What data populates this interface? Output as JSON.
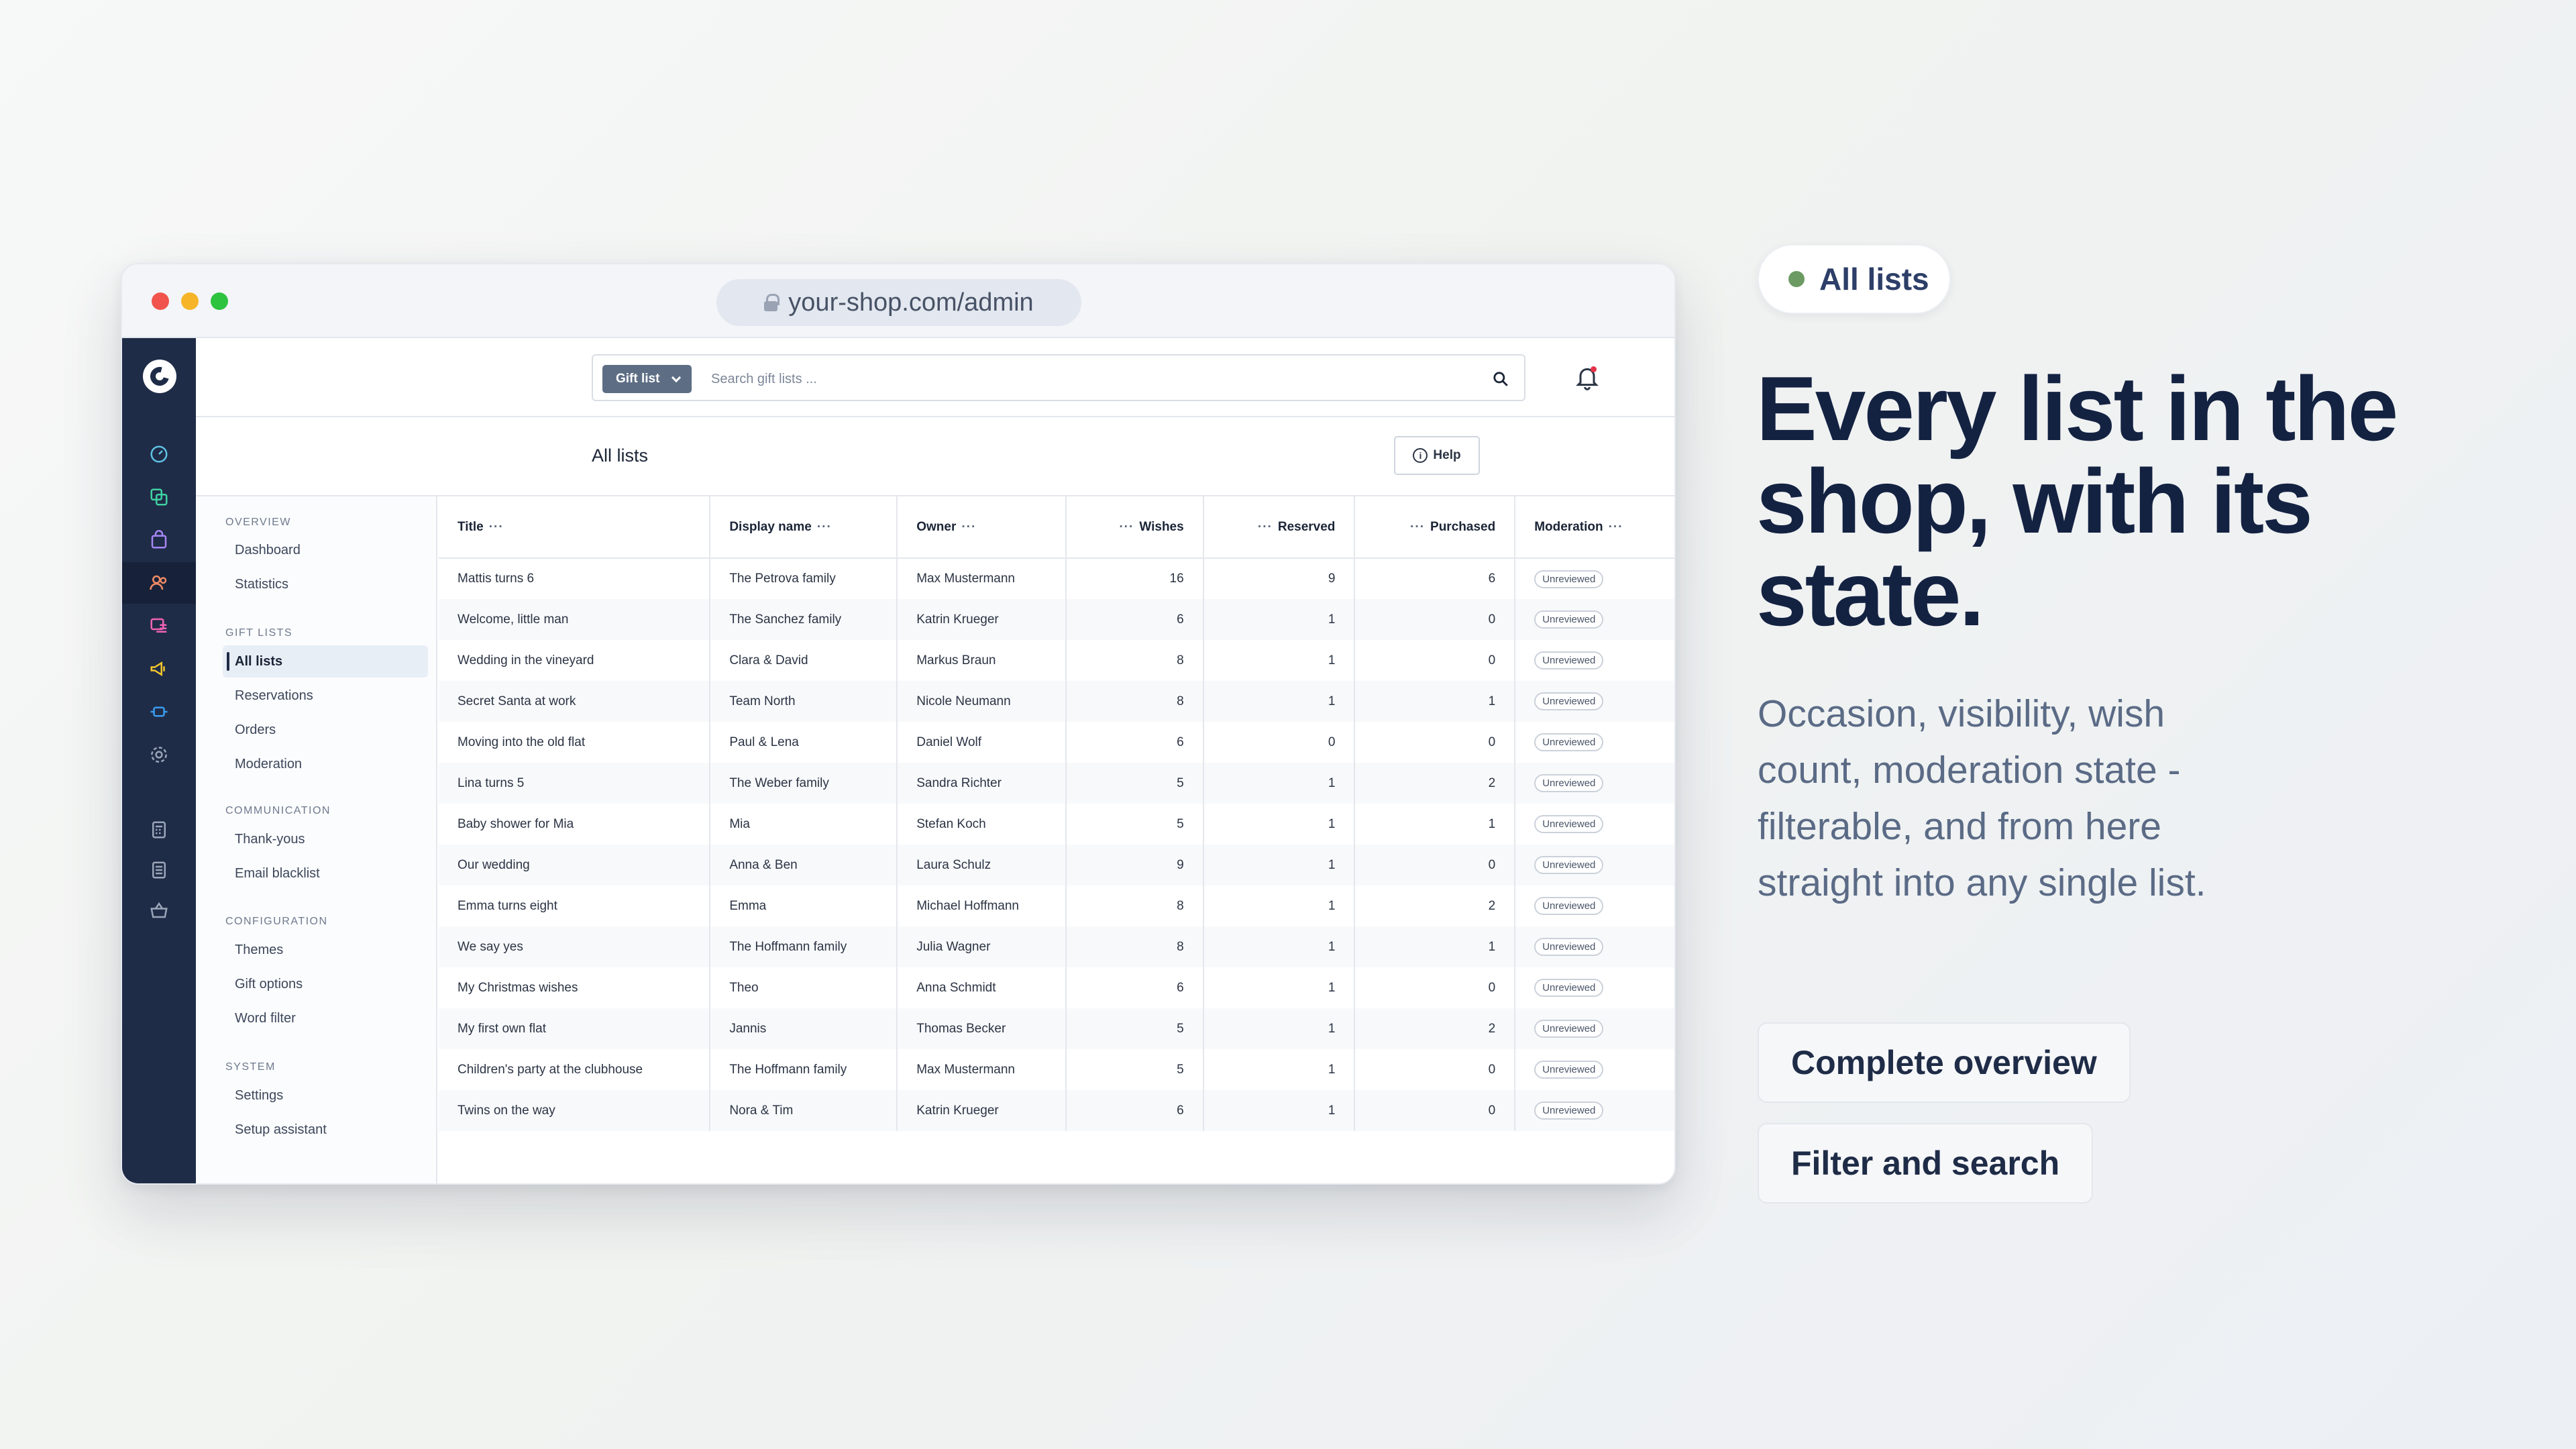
{
  "browser": {
    "url": "your-shop.com/admin"
  },
  "search": {
    "tag_label": "Gift list",
    "placeholder": "Search gift lists ..."
  },
  "page": {
    "title": "All lists",
    "help_label": "Help"
  },
  "sidebar": {
    "groups": [
      {
        "label": "Overview",
        "items": [
          "Dashboard",
          "Statistics"
        ]
      },
      {
        "label": "Gift lists",
        "items": [
          "All lists",
          "Reservations",
          "Orders",
          "Moderation"
        ]
      },
      {
        "label": "Communication",
        "items": [
          "Thank-yous",
          "Email blacklist"
        ]
      },
      {
        "label": "Configuration",
        "items": [
          "Themes",
          "Gift options",
          "Word filter"
        ]
      },
      {
        "label": "System",
        "items": [
          "Settings",
          "Setup assistant"
        ]
      }
    ],
    "active_item": "All lists"
  },
  "rail_icons": [
    "dashboard-icon",
    "catalog-icon",
    "orders-icon",
    "customers-icon",
    "content-icon",
    "marketing-icon",
    "extensions-icon",
    "settings-icon",
    "calculator-icon",
    "calculator-icon-2",
    "basket-icon"
  ],
  "table": {
    "columns": [
      "Title",
      "Display name",
      "Owner",
      "Wishes",
      "Reserved",
      "Purchased",
      "Moderation"
    ],
    "rows": [
      [
        "Mattis turns 6",
        "The Petrova family",
        "Max Mustermann",
        "16",
        "9",
        "6",
        "Unreviewed"
      ],
      [
        "Welcome, little man",
        "The Sanchez family",
        "Katrin Krueger",
        "6",
        "1",
        "0",
        "Unreviewed"
      ],
      [
        "Wedding in the vineyard",
        "Clara & David",
        "Markus Braun",
        "8",
        "1",
        "0",
        "Unreviewed"
      ],
      [
        "Secret Santa at work",
        "Team North",
        "Nicole Neumann",
        "8",
        "1",
        "1",
        "Unreviewed"
      ],
      [
        "Moving into the old flat",
        "Paul & Lena",
        "Daniel Wolf",
        "6",
        "0",
        "0",
        "Unreviewed"
      ],
      [
        "Lina turns 5",
        "The Weber family",
        "Sandra Richter",
        "5",
        "1",
        "2",
        "Unreviewed"
      ],
      [
        "Baby shower for Mia",
        "Mia",
        "Stefan Koch",
        "5",
        "1",
        "1",
        "Unreviewed"
      ],
      [
        "Our wedding",
        "Anna & Ben",
        "Laura Schulz",
        "9",
        "1",
        "0",
        "Unreviewed"
      ],
      [
        "Emma turns eight",
        "Emma",
        "Michael Hoffmann",
        "8",
        "1",
        "2",
        "Unreviewed"
      ],
      [
        "We say yes",
        "The Hoffmann family",
        "Julia Wagner",
        "8",
        "1",
        "1",
        "Unreviewed"
      ],
      [
        "My Christmas wishes",
        "Theo",
        "Anna Schmidt",
        "6",
        "1",
        "0",
        "Unreviewed"
      ],
      [
        "My first own flat",
        "Jannis",
        "Thomas Becker",
        "5",
        "1",
        "2",
        "Unreviewed"
      ],
      [
        "Children's party at the clubhouse",
        "The Hoffmann family",
        "Max Mustermann",
        "5",
        "1",
        "0",
        "Unreviewed"
      ],
      [
        "Twins on the way",
        "Nora & Tim",
        "Katrin Krueger",
        "6",
        "1",
        "0",
        "Unreviewed"
      ]
    ]
  },
  "marketing": {
    "pill_label": "All lists",
    "headline": "Every list in the shop, with its state.",
    "subtext": "Occasion, visibility, wish count, moderation state - filterable, and from here straight into any single list.",
    "cta_primary": "Complete overview",
    "cta_secondary": "Filter and search"
  },
  "colors": {
    "rail_bg": "#1f2c47",
    "headline": "#142242",
    "pill_dot": "#6b9a62",
    "notification_dot": "#e5334a"
  }
}
